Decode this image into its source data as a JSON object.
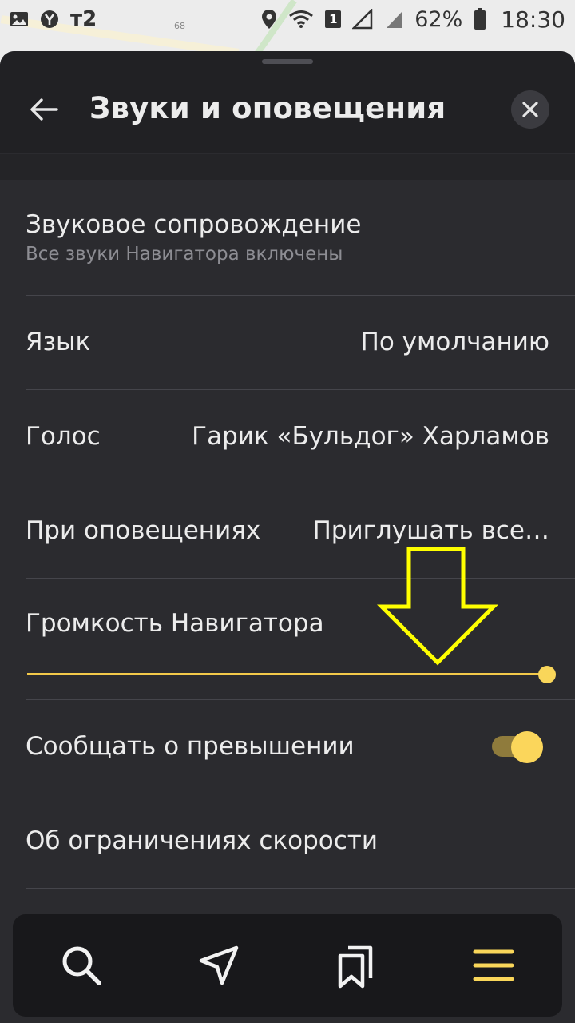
{
  "status_bar": {
    "carrier": "т2",
    "battery_percent": "62%",
    "time": "18:30",
    "sim_badge": "1",
    "icons": [
      "image-icon",
      "yandex-icon",
      "location-icon",
      "wifi-icon",
      "signal-icon",
      "battery-icon"
    ]
  },
  "map": {
    "label": "68"
  },
  "header": {
    "title": "Звуки и оповещения",
    "back_icon": "back-arrow-icon",
    "close_icon": "close-icon"
  },
  "settings": {
    "sound": {
      "label": "Звуковое сопровождение",
      "subtitle": "Все звуки Навигатора включены"
    },
    "language": {
      "label": "Язык",
      "value": "По умолчанию"
    },
    "voice": {
      "label": "Голос",
      "value": "Гарик «Бульдог» Харламов"
    },
    "notifications": {
      "label": "При оповещениях",
      "value": "Приглушать все…"
    },
    "volume": {
      "label": "Громкость Навигатора",
      "level": 1.0
    },
    "speeding": {
      "label": "Сообщать о превышении",
      "enabled": true
    },
    "speed_limits": {
      "label": "Об ограничениях скорости"
    }
  },
  "colors": {
    "accent": "#f9d65a",
    "background": "#2b2b2f",
    "header": "#212124",
    "annotation": "#ffff00"
  },
  "bottom_nav": {
    "items": [
      "search-icon",
      "navigation-arrow-icon",
      "bookmarks-icon",
      "menu-icon"
    ],
    "active": "menu-icon"
  }
}
